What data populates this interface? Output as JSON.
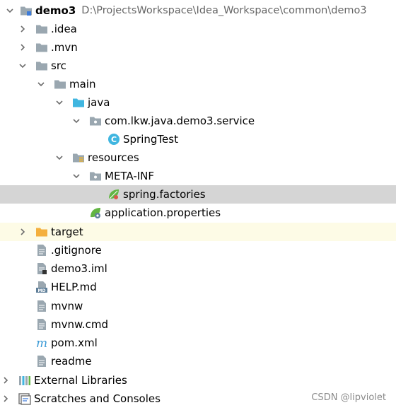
{
  "tree": {
    "root": {
      "name": "demo3",
      "path": "D:\\ProjectsWorkspace\\Idea_Workspace\\common\\demo3"
    },
    "nodes": {
      "idea": ".idea",
      "mvn": ".mvn",
      "src": "src",
      "main": "main",
      "java": "java",
      "package": "com.lkw.java.demo3.service",
      "spring_test": "SpringTest",
      "resources": "resources",
      "meta_inf": "META-INF",
      "spring_factories": "spring.factories",
      "application_properties": "application.properties",
      "target": "target",
      "gitignore": ".gitignore",
      "demo3_iml": "demo3.iml",
      "help_md": "HELP.md",
      "mvnw": "mvnw",
      "mvnw_cmd": "mvnw.cmd",
      "pom_xml": "pom.xml",
      "readme": "readme"
    },
    "external_libraries": "External Libraries",
    "scratches": "Scratches and Consoles"
  },
  "watermark": "CSDN @lipviolet",
  "colors": {
    "selected_row": "#d5d5d5",
    "excluded_row": "#fdfbe6",
    "folder_gray": "#9aa7b0",
    "folder_blue": "#40b6e0",
    "folder_orange": "#f4af3d",
    "class_icon": "#40b6e0",
    "spring_green": "#62b543"
  }
}
